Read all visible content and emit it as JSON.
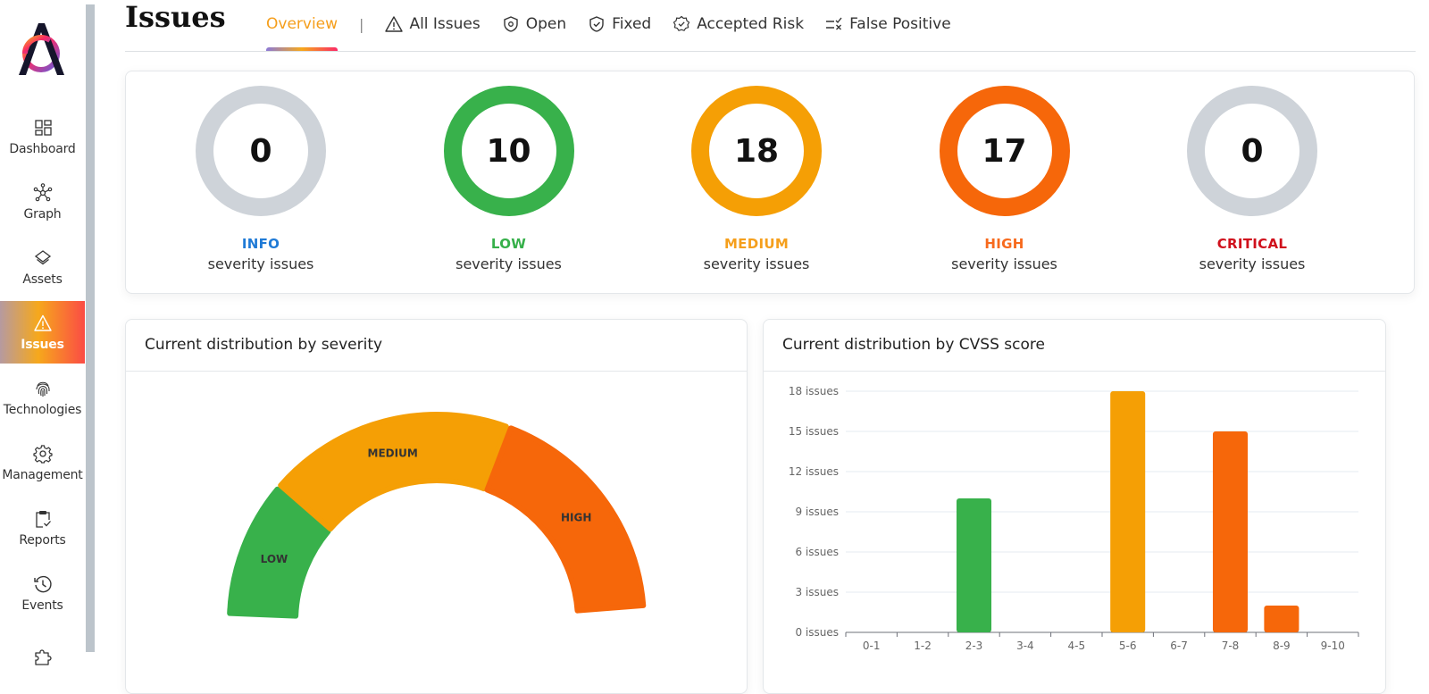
{
  "sidebar": {
    "logo": "app-logo",
    "items": [
      {
        "label": "Dashboard",
        "icon": "dashboard-icon",
        "active": false
      },
      {
        "label": "Graph",
        "icon": "graph-icon",
        "active": false
      },
      {
        "label": "Assets",
        "icon": "layers-icon",
        "active": false
      },
      {
        "label": "Issues",
        "icon": "warning-icon",
        "active": true
      },
      {
        "label": "Technologies",
        "icon": "fingerprint-icon",
        "active": false
      },
      {
        "label": "Management",
        "icon": "gear-icon",
        "active": false
      },
      {
        "label": "Reports",
        "icon": "clipboard-check-icon",
        "active": false
      },
      {
        "label": "Events",
        "icon": "history-icon",
        "active": false
      },
      {
        "label": "",
        "icon": "puzzle-icon",
        "active": false
      }
    ]
  },
  "header": {
    "title": "Issues",
    "separator": "|",
    "tabs": [
      {
        "label": "Overview",
        "icon": "",
        "active": true
      },
      {
        "label": "All Issues",
        "icon": "warning-icon",
        "active": false
      },
      {
        "label": "Open",
        "icon": "shield-at-icon",
        "active": false
      },
      {
        "label": "Fixed",
        "icon": "shield-check-icon",
        "active": false
      },
      {
        "label": "Accepted Risk",
        "icon": "badge-check-icon",
        "active": false
      },
      {
        "label": "False Positive",
        "icon": "list-x-icon",
        "active": false
      }
    ]
  },
  "severity_summary": [
    {
      "count": "0",
      "name": "INFO",
      "sub": "severity issues",
      "name_color": "#1f7ad6",
      "ring_color": "#ced3d9"
    },
    {
      "count": "10",
      "name": "LOW",
      "sub": "severity issues",
      "name_color": "#36b04a",
      "ring_color": "#38b14b"
    },
    {
      "count": "18",
      "name": "MEDIUM",
      "sub": "severity issues",
      "name_color": "#f59f1c",
      "ring_color": "#f59f05"
    },
    {
      "count": "17",
      "name": "HIGH",
      "sub": "severity issues",
      "name_color": "#f76a1d",
      "ring_color": "#f6670a"
    },
    {
      "count": "0",
      "name": "CRITICAL",
      "sub": "severity issues",
      "name_color": "#d0101c",
      "ring_color": "#ced3d9"
    }
  ],
  "chart_data": [
    {
      "type": "pie",
      "variant": "half-donut",
      "title": "Current distribution by severity",
      "categories": [
        "LOW",
        "MEDIUM",
        "HIGH"
      ],
      "values": [
        10,
        18,
        17
      ],
      "colors": [
        "#38b14b",
        "#f59f05",
        "#f6670a"
      ]
    },
    {
      "type": "bar",
      "title": "Current distribution by CVSS score",
      "categories": [
        "0-1",
        "1-2",
        "2-3",
        "3-4",
        "4-5",
        "5-6",
        "6-7",
        "7-8",
        "8-9",
        "9-10"
      ],
      "values": [
        0,
        0,
        10,
        0,
        0,
        18,
        0,
        15,
        2,
        0
      ],
      "colors": [
        "#38b14b",
        "#38b14b",
        "#38b14b",
        "#38b14b",
        "#f59f05",
        "#f59f05",
        "#f59f05",
        "#f6670a",
        "#f6670a",
        "#d0101c"
      ],
      "ylim": [
        0,
        18
      ],
      "yticks": [
        0,
        3,
        6,
        9,
        12,
        15,
        18
      ],
      "ytick_suffix": " issues",
      "xlabel": "",
      "ylabel": "",
      "grid": true
    }
  ]
}
